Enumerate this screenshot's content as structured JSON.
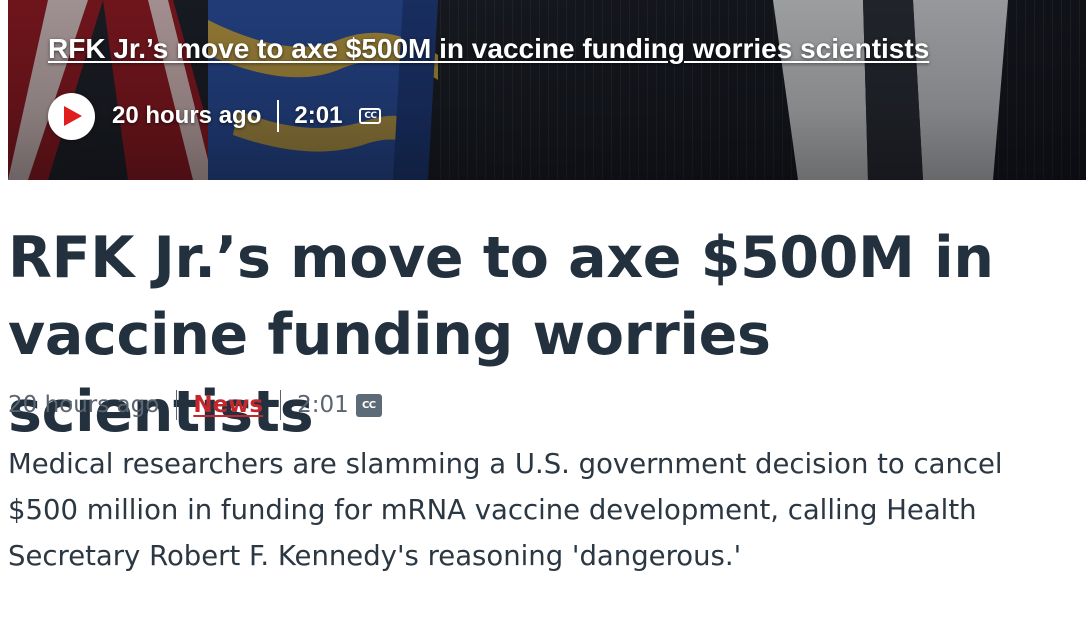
{
  "video": {
    "title": "RFK Jr.’s move to axe $500M in vaccine funding worries scientists",
    "time_ago": "20 hours ago",
    "duration": "2:01",
    "cc_label": "CC"
  },
  "article": {
    "headline": "RFK Jr.’s move to axe $500M in vaccine funding worries scientists",
    "time_ago": "20 hours ago",
    "category": "News",
    "duration": "2:01",
    "cc_label": "CC",
    "summary": "Medical researchers are slamming a U.S. government decision to cancel $500 million in funding for mRNA vaccine development, calling Health Secretary Robert F. Kennedy's reasoning 'dangerous.'"
  },
  "icons": {
    "play": "play-icon",
    "closed_captions": "closed-captions-icon"
  },
  "colors": {
    "headline": "#23313f",
    "category_link": "#c5282c",
    "play_triangle": "#e01e1e",
    "meta_text": "#5a6570"
  }
}
